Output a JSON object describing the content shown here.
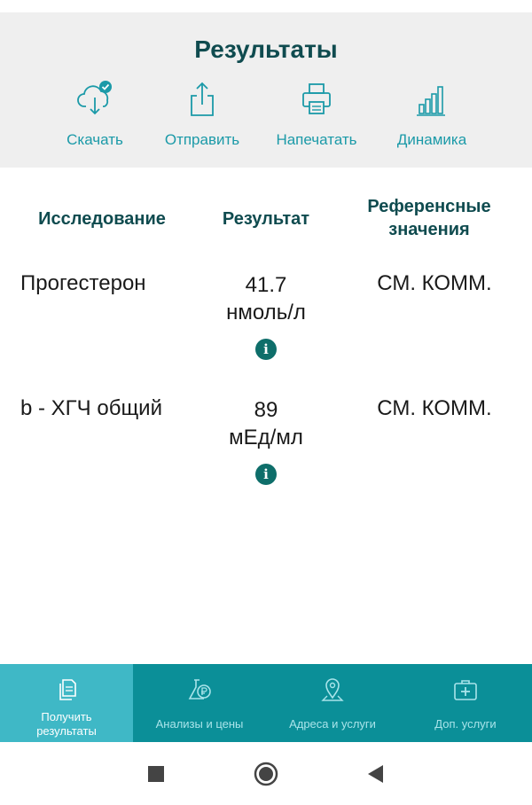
{
  "header": {
    "title": "Результаты",
    "actions": [
      {
        "label": "Скачать",
        "icon": "cloud-download-icon"
      },
      {
        "label": "Отправить",
        "icon": "share-icon"
      },
      {
        "label": "Напечатать",
        "icon": "printer-icon"
      },
      {
        "label": "Динамика",
        "icon": "bar-chart-icon"
      }
    ]
  },
  "table": {
    "headers": {
      "study": "Исследование",
      "result": "Результат",
      "reference_line1": "Референсные",
      "reference_line2": "значения"
    },
    "rows": [
      {
        "name": "Прогестерон",
        "value": "41.7",
        "unit": "нмоль/л",
        "reference": "СМ. КОММ.",
        "info": "i"
      },
      {
        "name": "b - ХГЧ общий",
        "value": "89",
        "unit": "мЕд/мл",
        "reference": "СМ. КОММ.",
        "info": "i"
      }
    ]
  },
  "bottom_nav": {
    "items": [
      {
        "label_line1": "Получить",
        "label_line2": "результаты",
        "icon": "document-copy-icon",
        "active": true
      },
      {
        "label": "Анализы и цены",
        "icon": "flask-ruble-icon",
        "active": false
      },
      {
        "label": "Адреса и услуги",
        "icon": "map-pin-icon",
        "active": false
      },
      {
        "label": "Доп. услуги",
        "icon": "medical-kit-icon",
        "active": false
      }
    ]
  },
  "colors": {
    "accent": "#1b9aa8",
    "header_text": "#0f4b4f",
    "nav_bg": "#0b8f98",
    "nav_active": "#3fb8c6",
    "info_badge": "#0e6e6a"
  }
}
